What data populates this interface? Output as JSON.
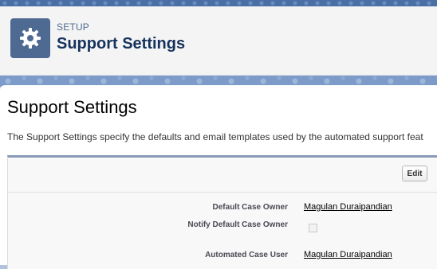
{
  "header": {
    "breadcrumb": "SETUP",
    "title": "Support Settings",
    "icon": "gear-icon"
  },
  "page": {
    "title": "Support Settings",
    "description": "The Support Settings specify the defaults and email templates used by the automated support feat"
  },
  "panel": {
    "edit_label": "Edit",
    "fields": [
      {
        "label": "Default Case Owner",
        "value": "Magulan Duraipandian",
        "type": "link"
      },
      {
        "label": "Notify Default Case Owner",
        "value": false,
        "type": "checkbox"
      },
      {
        "label": "Automated Case User",
        "value": "Magulan Duraipandian",
        "type": "link"
      }
    ]
  },
  "colors": {
    "header_icon_bg": "#4f6a92",
    "header_title": "#16325c",
    "panel_border": "#8a9bb8"
  }
}
